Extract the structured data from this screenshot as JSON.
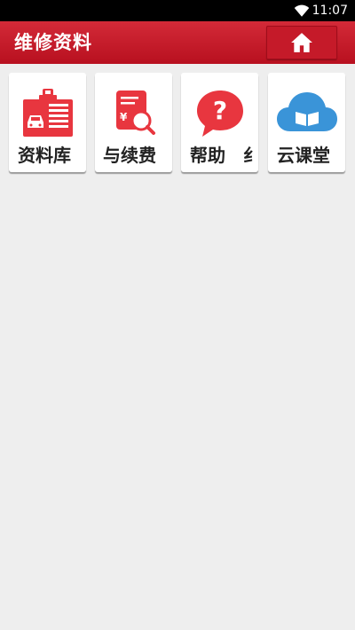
{
  "status_bar": {
    "time": "11:07"
  },
  "app_bar": {
    "title": "维修资料"
  },
  "tiles": [
    {
      "label": "资料库"
    },
    {
      "label": "与续费"
    },
    {
      "label": "帮助　纟"
    },
    {
      "label": "云课堂"
    }
  ],
  "colors": {
    "app_bar": "#c51a29",
    "icon_red": "#e8363f",
    "icon_blue": "#3a94d8",
    "background": "#eeeeee"
  }
}
